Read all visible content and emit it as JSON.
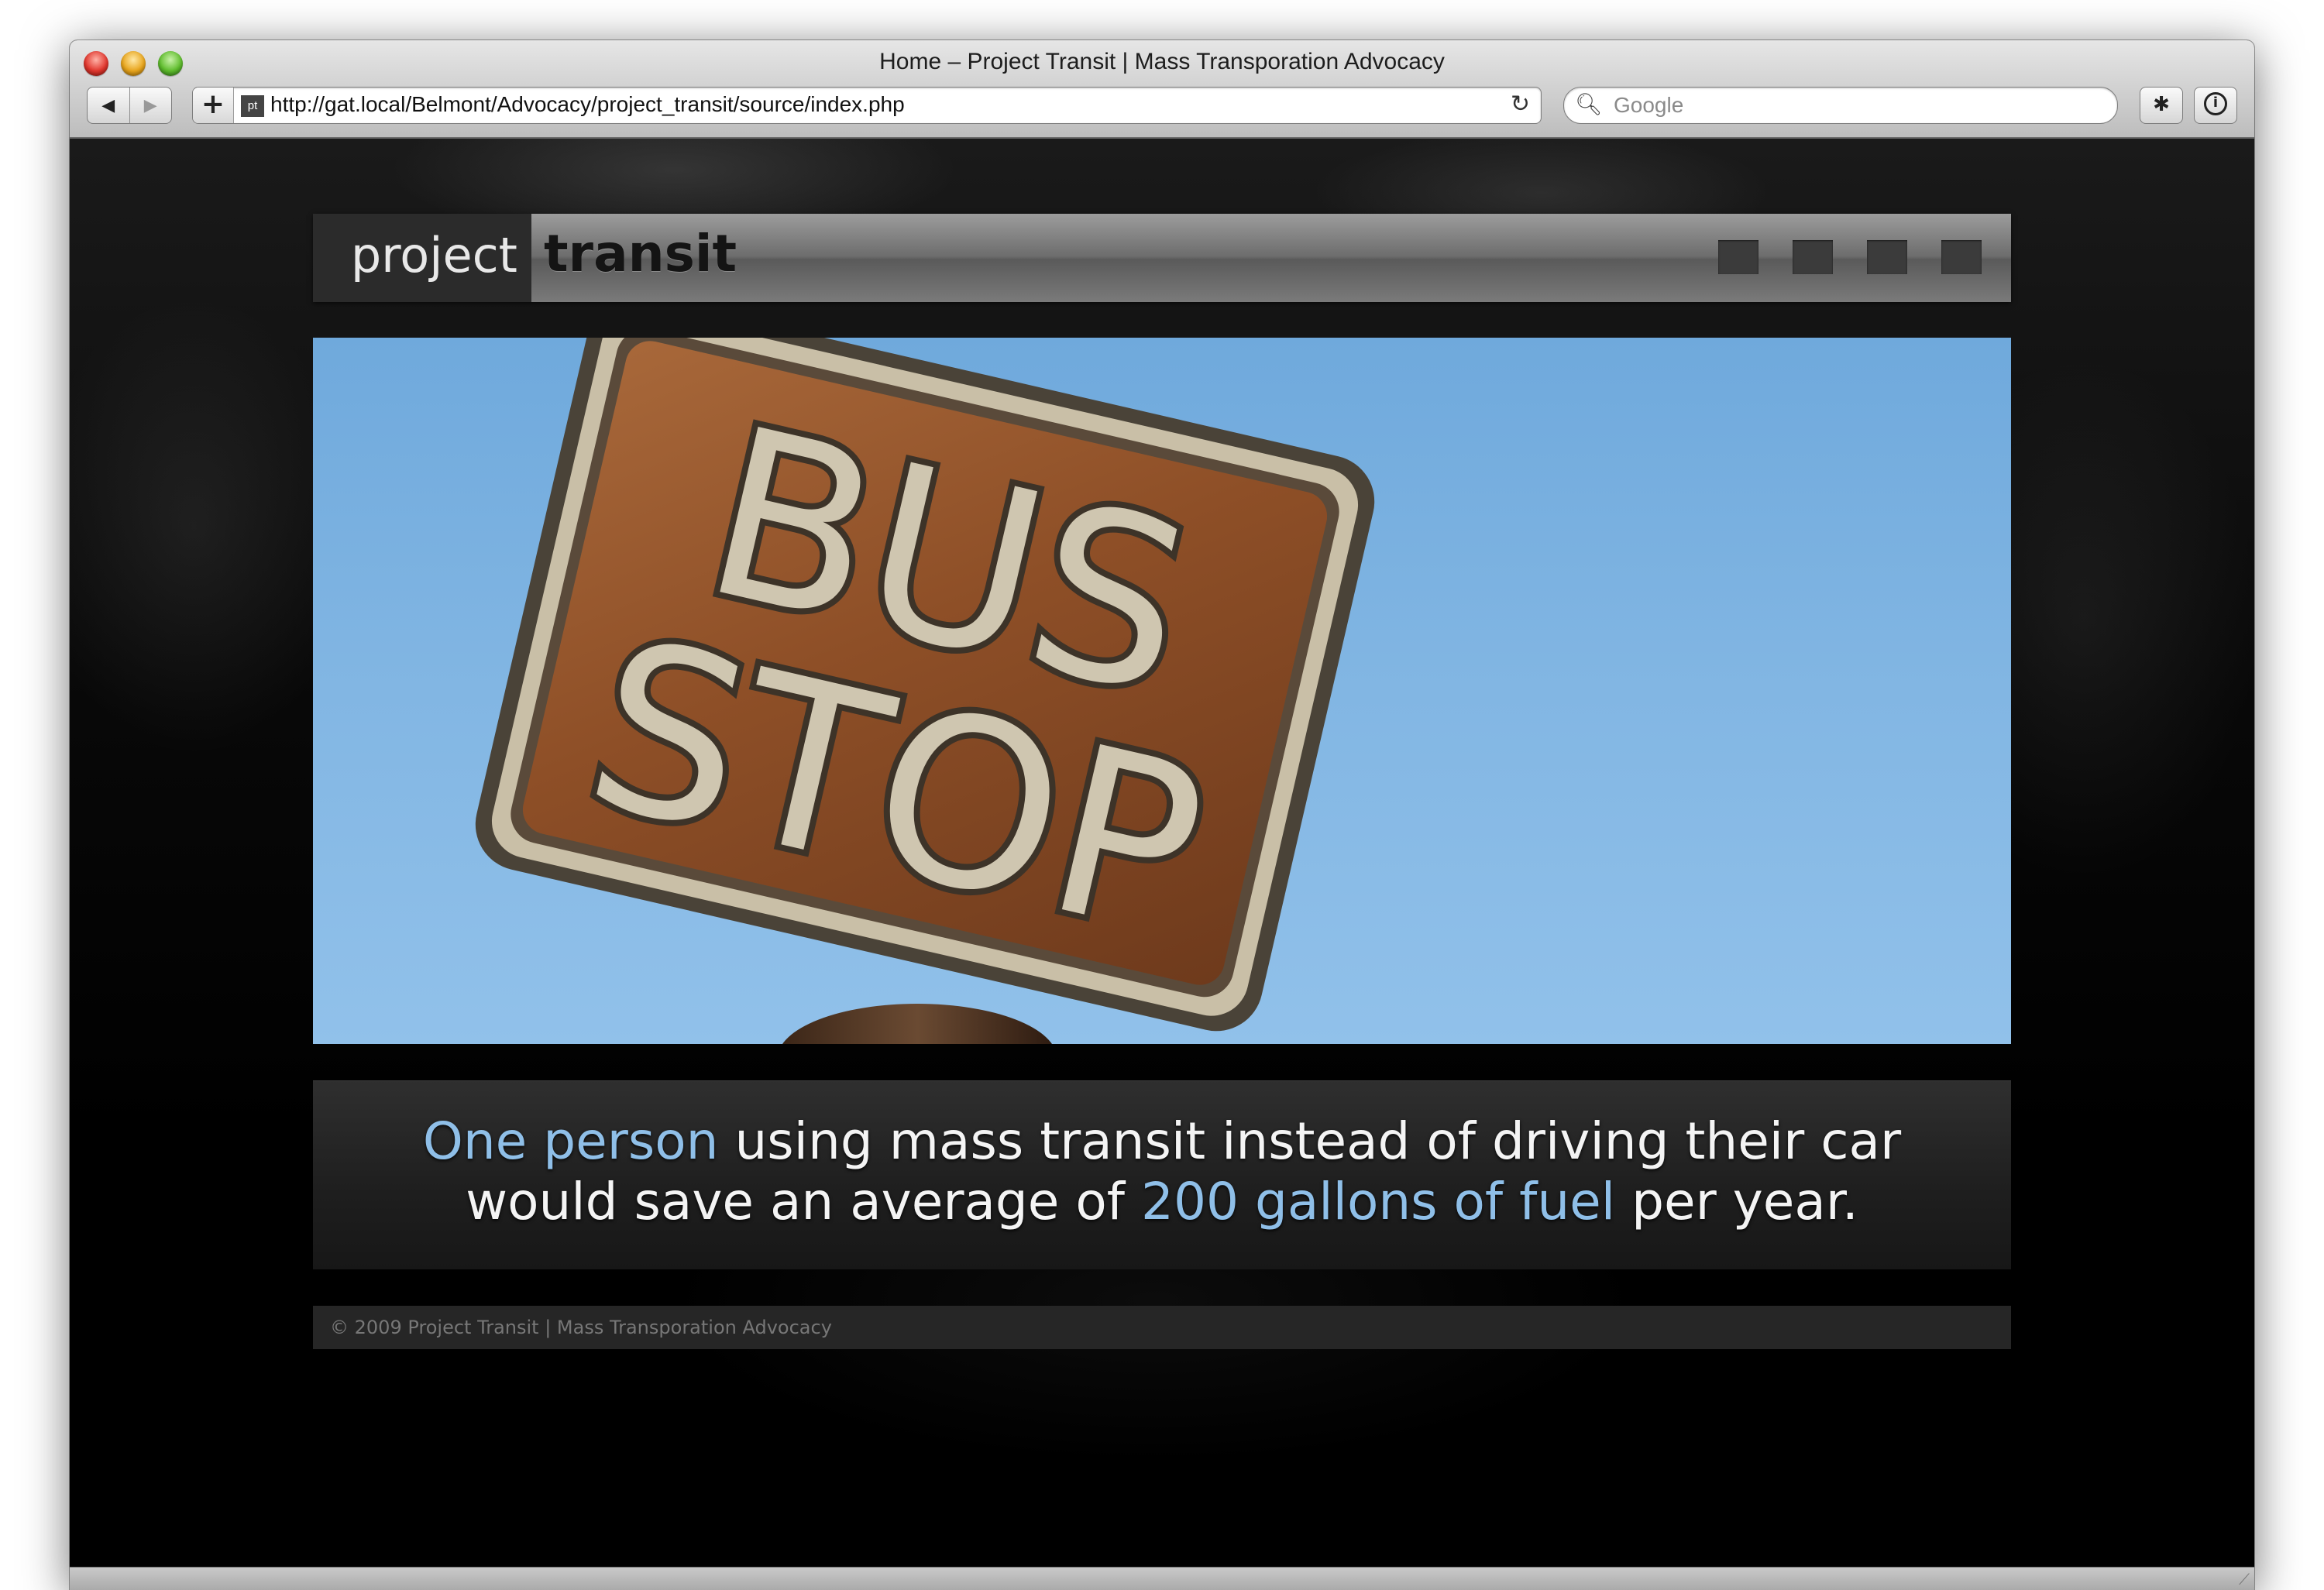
{
  "browser": {
    "window_title": "Home – Project Transit | Mass Transporation Advocacy",
    "back_glyph": "◀",
    "forward_glyph": "▶",
    "add_bookmark_glyph": "+",
    "favicon_text": "pt",
    "url": "http://gat.local/Belmont/Advocacy/project_transit/source/index.php",
    "reload_glyph": "↻",
    "search_placeholder": "Google",
    "search_icon": "magnifier-icon",
    "bug_icon": "bug-icon",
    "info_icon": "info-icon"
  },
  "site": {
    "logo_word1": "project",
    "logo_word2": "transit",
    "nav_items": 4,
    "hero_image_text": [
      "BUS",
      "STOP"
    ],
    "tagline": {
      "line1_highlight": "One person",
      "line1_rest": " using mass transit instead of driving their car",
      "line2_start": "would save an average of ",
      "line2_highlight": "200 gallons of fuel",
      "line2_end": " per year."
    },
    "footer": "© 2009 Project Transit | Mass Transporation Advocacy"
  },
  "colors": {
    "highlight": "#8fbfe8",
    "sky": "#82b6e3",
    "sign_rust": "#9a5a30"
  }
}
